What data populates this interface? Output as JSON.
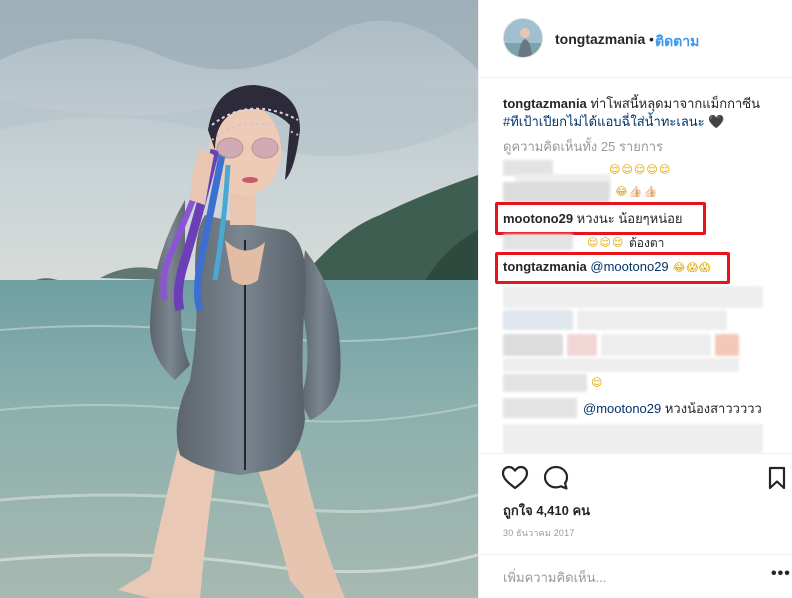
{
  "header": {
    "username": "tongtazmania",
    "separator": "•",
    "follow_label": "ติดตาม",
    "avatar_icon": "profile-avatar"
  },
  "caption": {
    "username": "tongtazmania",
    "text": " ท่าโพสนี้หลุดมาจากแม็กกาซีน ",
    "hashtag": "#ทีเป้าเปียกไม่ได้แอบฉี่ใส่น้ำทะเลนะ",
    "emoji": " 🖤"
  },
  "view_all_comments": "ดูความคิดเห็นทั้ง 25 รายการ",
  "comments": [
    {
      "id": "c1",
      "emoji": "😌😌😌😌😌"
    },
    {
      "id": "c2",
      "emoji": "😂👍🏻👍🏻"
    },
    {
      "id": "c3",
      "username": "mootono29",
      "text": " หวงนะ น้อยๆหน่อย",
      "highlighted": true
    },
    {
      "id": "c4",
      "emoji": "😌😌😌",
      "text": "ต้องตา"
    },
    {
      "id": "c5",
      "username": "tongtazmania",
      "mention": " @mootono29",
      "emoji": " 😂😱😱",
      "highlighted": true
    },
    {
      "id": "c6",
      "emoji": "😌"
    },
    {
      "id": "c7",
      "mention": "@mootono29",
      "text": " หวงน้องสาววววว"
    }
  ],
  "actions": {
    "like_icon": "heart-outline-icon",
    "comment_icon": "comment-bubble-icon",
    "save_icon": "bookmark-icon",
    "likes_text": "ถูกใจ 4,410 คน",
    "date": "30 ธันวาคม 2017"
  },
  "add_comment": {
    "placeholder": "เพิ่มความคิดเห็น...",
    "more_label": "•••"
  },
  "colors": {
    "link_blue": "#3897f0",
    "hashtag_blue": "#003569",
    "highlight_red": "#e8141c",
    "border": "#efefef"
  }
}
